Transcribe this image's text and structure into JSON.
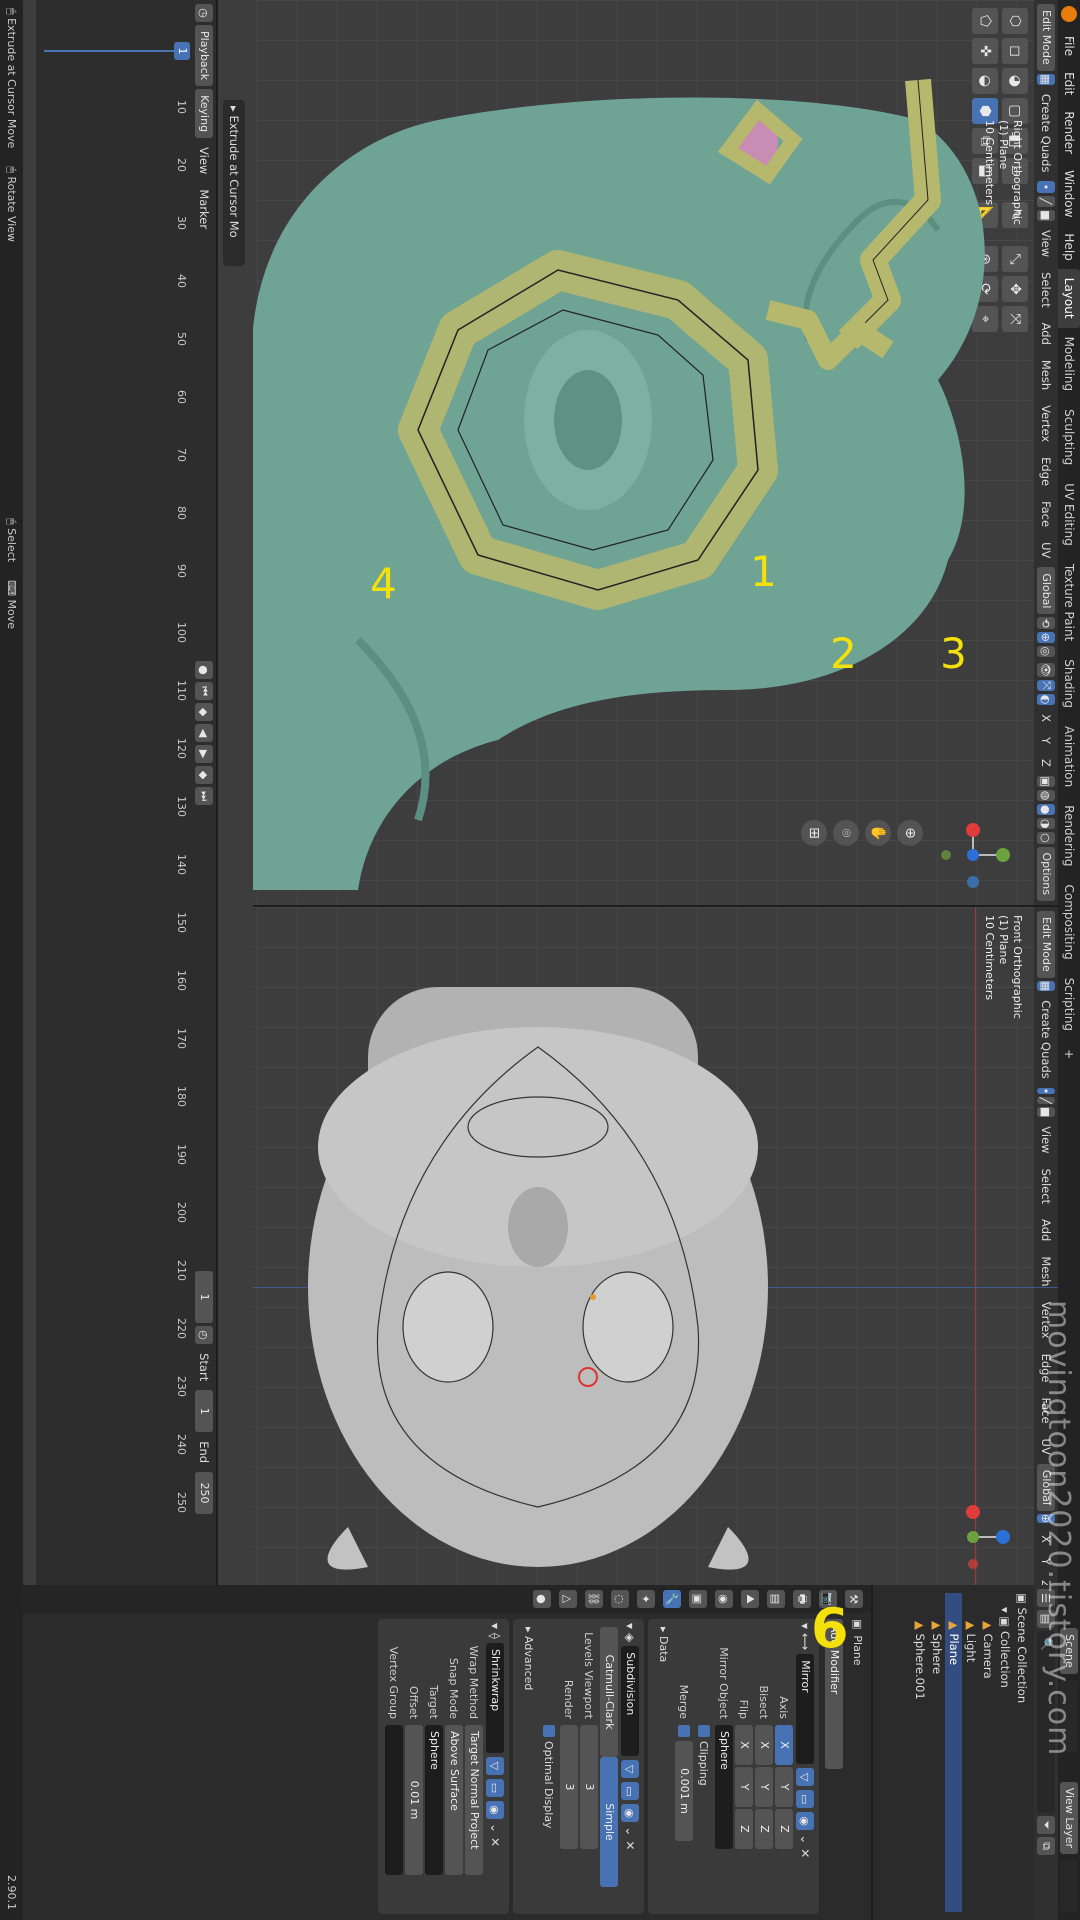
{
  "app": {
    "version": "2.90.1",
    "step_number": "6",
    "watermark": "movingtoon2020.tistory.com"
  },
  "menu": [
    "File",
    "Edit",
    "Render",
    "Window",
    "Help"
  ],
  "workspaces": [
    "Layout",
    "Modeling",
    "Sculpting",
    "UV Editing",
    "Texture Paint",
    "Shading",
    "Animation",
    "Rendering",
    "Compositing",
    "Scripting",
    "+"
  ],
  "scene": {
    "label": "Scene",
    "view_layer": "View Layer"
  },
  "viewport_header": {
    "mode": "Edit Mode",
    "create_quads": "Create Quads",
    "menus": [
      "View",
      "Select",
      "Add",
      "Mesh",
      "Vertex",
      "Edge",
      "Face",
      "UV"
    ],
    "orientation": "Global",
    "axes": [
      "X",
      "Y",
      "Z"
    ],
    "options": "Options"
  },
  "left_view": {
    "title": "Right Orthographic",
    "object": "(1) Plane",
    "scale": "10 Centimeters",
    "annotations": [
      "1",
      "2",
      "3",
      "4"
    ]
  },
  "right_view": {
    "title": "Front Orthographic",
    "object": "(1) Plane",
    "scale": "10 Centimeters"
  },
  "operator_panel": {
    "label": "Extrude at Cursor Mo"
  },
  "timeline": {
    "menus": [
      "Playback",
      "Keying",
      "View",
      "Marker"
    ],
    "current_frame": "1",
    "start_label": "Start",
    "start": "1",
    "end_label": "End",
    "end": "250",
    "ticks": [
      "10",
      "20",
      "30",
      "40",
      "50",
      "60",
      "70",
      "80",
      "90",
      "100",
      "110",
      "120",
      "130",
      "140",
      "150",
      "160",
      "170",
      "180",
      "190",
      "200",
      "210",
      "220",
      "230",
      "240",
      "250"
    ]
  },
  "statusbar": [
    "Extrude at Cursor Move",
    "Rotate View",
    "Select",
    "Move"
  ],
  "outliner": {
    "root": "Scene Collection",
    "items": [
      {
        "label": "Collection"
      },
      {
        "label": "Camera"
      },
      {
        "label": "Light"
      },
      {
        "label": "Plane"
      },
      {
        "label": "Sphere"
      },
      {
        "label": "Sphere.001"
      }
    ]
  },
  "properties": {
    "object": "Plane",
    "add_modifier": "Add Modifier",
    "mirror": {
      "name": "Mirror",
      "axis_label": "Axis",
      "bisect_label": "Bisect",
      "flip_label": "Flip",
      "xyz": [
        "X",
        "Y",
        "Z"
      ],
      "mirror_object_label": "Mirror Object",
      "mirror_object": "Sphere",
      "clipping": "Clipping",
      "merge_label": "Merge",
      "merge_value": "0.001 m",
      "data_label": "Data"
    },
    "subdivision": {
      "name": "Subdivision",
      "catmull": "Catmull-Clark",
      "simple": "Simple",
      "levels_label": "Levels Viewport",
      "levels": "3",
      "render_label": "Render",
      "render": "3",
      "optimal": "Optimal Display",
      "advanced": "Advanced"
    },
    "shrinkwrap": {
      "name": "Shrinkwrap",
      "wrap_label": "Wrap Method",
      "wrap": "Target Normal Project",
      "snap_label": "Snap Mode",
      "snap": "Above Surface",
      "target_label": "Target",
      "target": "Sphere",
      "offset_label": "Offset",
      "offset": "0.01 m",
      "vgroup_label": "Vertex Group"
    }
  },
  "colors": {
    "accent": "#4772b3",
    "head_left": "#6fa394",
    "head_right": "#bdbdbd",
    "annotation": "#f5e10a",
    "face_fill": "#b6b86e"
  }
}
